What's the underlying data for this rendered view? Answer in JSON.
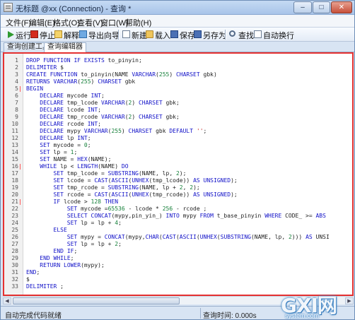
{
  "window": {
    "title": "无标题 @xx (Connection) - 查询 *",
    "min_label": "–",
    "max_label": "□",
    "close_label": "✕"
  },
  "menu": [
    "文件(F)",
    "编辑(E)",
    "格式(O)",
    "查看(V)",
    "窗口(W)",
    "帮助(H)"
  ],
  "toolbar": {
    "run": "运行",
    "stop": "停止",
    "explain": "解释",
    "export_wizard": "导出向导",
    "new": "新建",
    "load": "载入",
    "save": "保存",
    "save_as": "另存为",
    "find": "查找",
    "word_wrap": "自动换行",
    "icons": [
      "play-icon",
      "stop-icon",
      "explain-icon",
      "export-icon",
      "new-file-icon",
      "folder-icon",
      "save-icon",
      "save-as-icon",
      "search-icon",
      "word-wrap-icon"
    ],
    "colors": {
      "run": "#2f9a2f",
      "stop": "#d42a1e"
    }
  },
  "tabs": [
    "查询创建工具",
    "查询编辑器"
  ],
  "active_tab": "查询编辑器",
  "editor": {
    "border_color": "#e53131",
    "lines": [
      {
        "n": "1",
        "fold": "",
        "text": "DROP FUNCTION IF EXISTS to_pinyin;"
      },
      {
        "n": "2",
        "fold": "",
        "text": "DELIMITER $"
      },
      {
        "n": "3",
        "fold": "",
        "text": "CREATE FUNCTION to_pinyin(NAME VARCHAR(255) CHARSET gbk)"
      },
      {
        "n": "4",
        "fold": "",
        "text": "RETURNS VARCHAR(255) CHARSET gbk"
      },
      {
        "n": "5",
        "fold": "-",
        "text": "BEGIN"
      },
      {
        "n": "6",
        "fold": "",
        "text": "    DECLARE mycode INT;"
      },
      {
        "n": "7",
        "fold": "",
        "text": "    DECLARE tmp_lcode VARCHAR(2) CHARSET gbk;"
      },
      {
        "n": "8",
        "fold": "",
        "text": "    DECLARE lcode INT;"
      },
      {
        "n": "9",
        "fold": "",
        "text": "    DECLARE tmp_rcode VARCHAR(2) CHARSET gbk;"
      },
      {
        "n": "10",
        "fold": "",
        "text": "    DECLARE rcode INT;"
      },
      {
        "n": "11",
        "fold": "",
        "text": "    DECLARE mypy VARCHAR(255) CHARSET gbk DEFAULT '';"
      },
      {
        "n": "12",
        "fold": "",
        "text": "    DECLARE lp INT;"
      },
      {
        "n": "13",
        "fold": "",
        "text": "    SET mycode = 0;"
      },
      {
        "n": "14",
        "fold": "",
        "text": "    SET lp = 1;"
      },
      {
        "n": "15",
        "fold": "",
        "text": "    SET NAME = HEX(NAME);"
      },
      {
        "n": "16",
        "fold": "-",
        "text": "    WHILE lp < LENGTH(NAME) DO"
      },
      {
        "n": "17",
        "fold": "",
        "text": "        SET tmp_lcode = SUBSTRING(NAME, lp, 2);"
      },
      {
        "n": "18",
        "fold": "",
        "text": "        SET lcode = CAST(ASCII(UNHEX(tmp_lcode)) AS UNSIGNED);"
      },
      {
        "n": "19",
        "fold": "",
        "text": "        SET tmp_rcode = SUBSTRING(NAME, lp + 2, 2);"
      },
      {
        "n": "20",
        "fold": "",
        "text": "        SET rcode = CAST(ASCII(UNHEX(tmp_rcode)) AS UNSIGNED);"
      },
      {
        "n": "21",
        "fold": "-",
        "text": "        IF lcode > 128 THEN"
      },
      {
        "n": "22",
        "fold": "",
        "text": "            SET mycode =65536 - lcode * 256 - rcode ;"
      },
      {
        "n": "23",
        "fold": "",
        "text": "            SELECT CONCAT(mypy,pin_yin_) INTO mypy FROM t_base_pinyin WHERE CODE_ >= ABS"
      },
      {
        "n": "24",
        "fold": "",
        "text": "            SET lp = lp + 4;"
      },
      {
        "n": "25",
        "fold": "",
        "text": "        ELSE"
      },
      {
        "n": "26",
        "fold": "",
        "text": "            SET mypy = CONCAT(mypy,CHAR(CAST(ASCII(UNHEX(SUBSTRING(NAME, lp, 2))) AS UNSI"
      },
      {
        "n": "27",
        "fold": "",
        "text": "            SET lp = lp + 2;"
      },
      {
        "n": "28",
        "fold": "",
        "text": "        END IF;"
      },
      {
        "n": "29",
        "fold": "",
        "text": "    END WHILE;"
      },
      {
        "n": "30",
        "fold": "",
        "text": "    RETURN LOWER(mypy);"
      },
      {
        "n": "31",
        "fold": "",
        "text": "END;"
      },
      {
        "n": "32",
        "fold": "",
        "text": "$"
      },
      {
        "n": "33",
        "fold": "",
        "text": "DELIMITER ;"
      }
    ]
  },
  "hscroll": {
    "left_arrow": "◀",
    "right_arrow": "▶"
  },
  "status": {
    "left": "自动完成代码就绪",
    "right": "查询时间: 0.000s"
  },
  "watermark": {
    "logo": "GXI网",
    "site": "system.com"
  }
}
